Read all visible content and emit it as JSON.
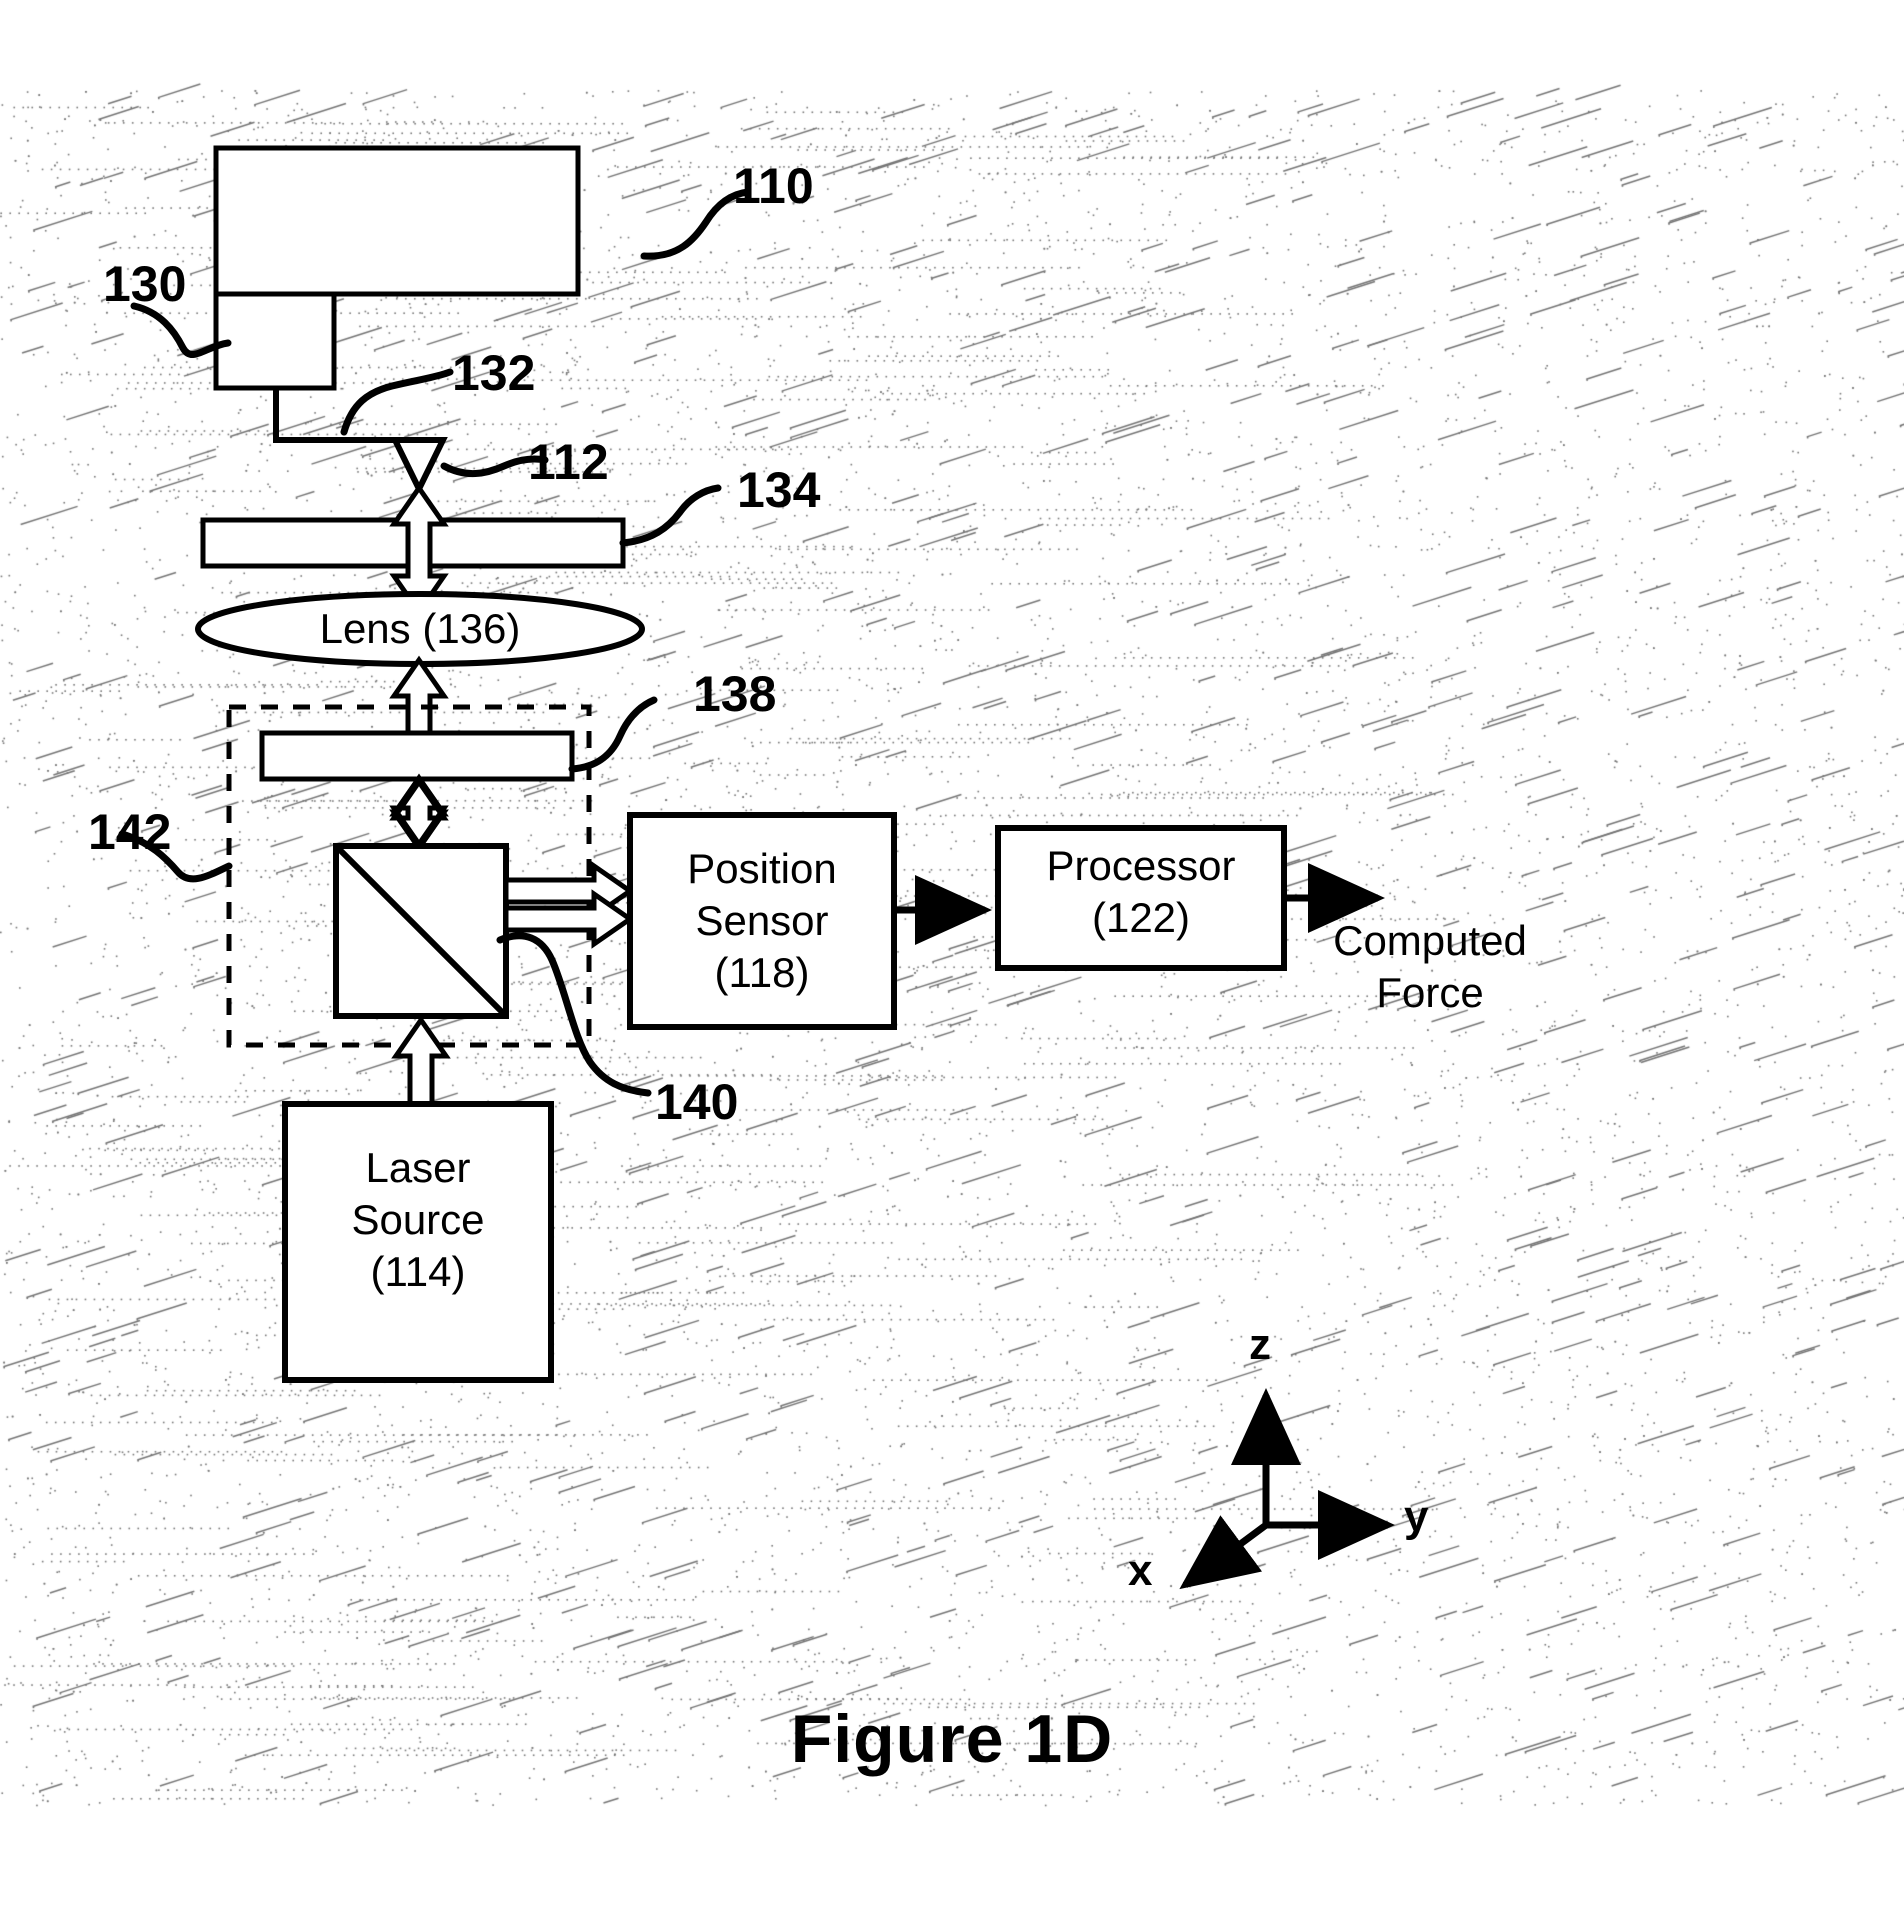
{
  "figure": {
    "caption": "Figure 1D",
    "system_ref": "110"
  },
  "labels": {
    "ref_110": "110",
    "ref_130": "130",
    "ref_132": "132",
    "ref_112": "112",
    "ref_134": "134",
    "ref_138": "138",
    "ref_142": "142",
    "ref_140": "140"
  },
  "blocks": {
    "lens": {
      "name": "Lens (136)"
    },
    "position_sensor": {
      "line1": "Position",
      "line2": "Sensor",
      "line3": "(118)"
    },
    "processor": {
      "line1": "Processor",
      "line2": "(122)"
    },
    "laser_source": {
      "line1": "Laser",
      "line2": "Source",
      "line3": "(114)"
    }
  },
  "output": {
    "line1": "Computed",
    "line2": "Force"
  },
  "axes": {
    "z": "z",
    "y": "y",
    "x": "x"
  },
  "colors": {
    "ink": "#000000",
    "paper": "#ffffff"
  }
}
